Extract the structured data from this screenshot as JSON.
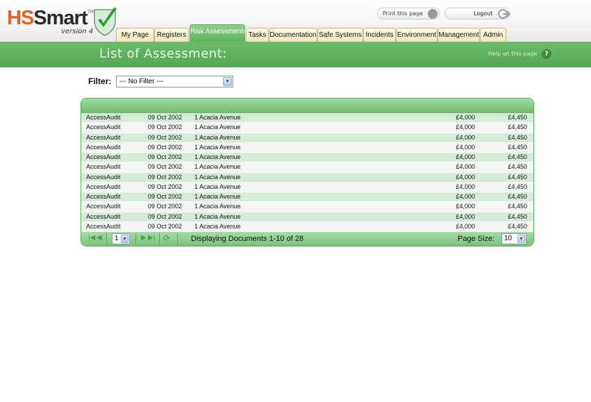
{
  "logo": {
    "hs": "HS",
    "smart": "Smart",
    "tm": "TM",
    "version": "version 4"
  },
  "header": {
    "print_label": "Print this page",
    "logout_label": "Logout"
  },
  "tabs": [
    {
      "label": "My Page",
      "active": false
    },
    {
      "label": "Registers",
      "active": false
    },
    {
      "label": "Risk Assessments",
      "active": true
    },
    {
      "label": "Tasks",
      "active": false
    },
    {
      "label": "Documentation",
      "active": false
    },
    {
      "label": "Safe Systems",
      "active": false
    },
    {
      "label": "Incidents",
      "active": false
    },
    {
      "label": "Environment",
      "active": false
    },
    {
      "label": "Management",
      "active": false
    },
    {
      "label": "Admin",
      "active": false
    }
  ],
  "page": {
    "title": "List of Assessment:",
    "help_link": "Help on this page",
    "help_icon": "?"
  },
  "filter": {
    "label": "Filter:",
    "selected": "--- No Filter ---"
  },
  "grid": {
    "rows": [
      {
        "type": "AccessAudit",
        "date": "09 Oct 2002",
        "address": "1 Acacia Avenue",
        "amount1": "£4,000",
        "amount2": "£4,450"
      },
      {
        "type": "AccessAudit",
        "date": "09 Oct 2002",
        "address": "1 Acacia Avenue",
        "amount1": "£4,000",
        "amount2": "£4,450"
      },
      {
        "type": "AccessAudit",
        "date": "09 Oct 2002",
        "address": "1 Acacia Avenue",
        "amount1": "£4,000",
        "amount2": "£4,450"
      },
      {
        "type": "AccessAudit",
        "date": "09 Oct 2002",
        "address": "1 Acacia Avenue",
        "amount1": "£4,000",
        "amount2": "£4,450"
      },
      {
        "type": "AccessAudit",
        "date": "09 Oct 2002",
        "address": "1 Acacia Avenue",
        "amount1": "£4,000",
        "amount2": "£4,450"
      },
      {
        "type": "AccessAudit",
        "date": "09 Oct 2002",
        "address": "1 Acacia Avenue",
        "amount1": "£4,000",
        "amount2": "£4,450"
      },
      {
        "type": "AccessAudit",
        "date": "09 Oct 2002",
        "address": "1 Acacia Avenue",
        "amount1": "£4,000",
        "amount2": "£4,450"
      },
      {
        "type": "AccessAudit",
        "date": "09 Oct 2002",
        "address": "1 Acacia Avenue",
        "amount1": "£4,000",
        "amount2": "£4,450"
      },
      {
        "type": "AccessAudit",
        "date": "09 Oct 2002",
        "address": "1 Acacia Avenue",
        "amount1": "£4,000",
        "amount2": "£4,450"
      },
      {
        "type": "AccessAudit",
        "date": "09 Oct 2002",
        "address": "1 Acacia Avenue",
        "amount1": "£4,000",
        "amount2": "£4,450"
      },
      {
        "type": "AccessAudit",
        "date": "09 Oct 2002",
        "address": "1 Acacia Avenue",
        "amount1": "£4,000",
        "amount2": "£4,450"
      },
      {
        "type": "AccessAudit",
        "date": "09 Oct 2002",
        "address": "1 Acacia Avenue",
        "amount1": "£4,000",
        "amount2": "£4,450"
      }
    ]
  },
  "pager": {
    "page_selected": "1",
    "status": "Displaying Documents 1-10 of 28",
    "page_size_label": "Page Size:",
    "page_size": "10"
  },
  "icons": {
    "first": "first-page-icon",
    "prev": "prev-page-icon",
    "next": "next-page-icon",
    "last": "last-page-icon",
    "refresh": "refresh-icon"
  },
  "colors": {
    "brand_green": "#54a654",
    "brand_orange": "#e2622b",
    "tab_bg": "#f3e6bd"
  }
}
